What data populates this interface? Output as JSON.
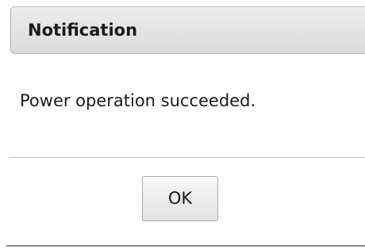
{
  "dialog": {
    "title": "Notification",
    "message": "Power operation succeeded.",
    "ok_label": "OK"
  }
}
